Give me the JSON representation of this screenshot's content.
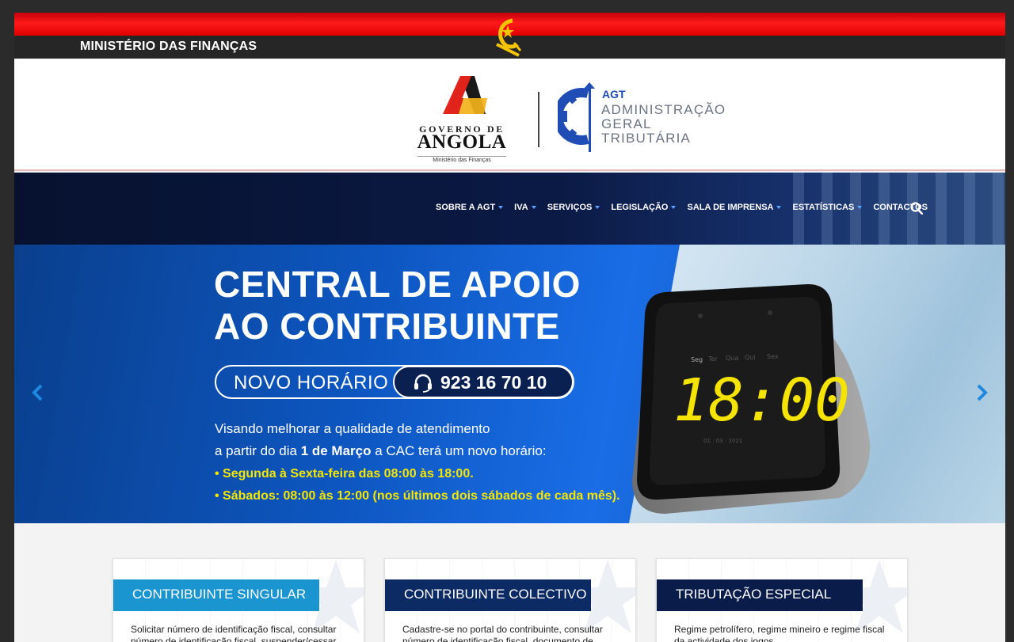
{
  "header": {
    "ministry": "MINISTÉRIO DAS FINANÇAS"
  },
  "logos": {
    "gov_line1": "GOVERNO DE",
    "gov_line2": "ANGOLA",
    "gov_line3": "Ministério das Finanças",
    "agt_short": "AGT",
    "agt_line1": "ADMINISTRAÇÃO",
    "agt_line2": "GERAL",
    "agt_line3": "TRIBUTÁRIA"
  },
  "nav": {
    "items": [
      {
        "label": "SOBRE A AGT",
        "dropdown": true
      },
      {
        "label": "IVA",
        "dropdown": true
      },
      {
        "label": "SERVIÇOS",
        "dropdown": true
      },
      {
        "label": "LEGISLAÇÃO",
        "dropdown": true
      },
      {
        "label": "SALA DE IMPRENSA",
        "dropdown": true
      },
      {
        "label": "ESTATÍSTICAS",
        "dropdown": true
      },
      {
        "label": "CONTACTOS",
        "dropdown": false
      }
    ],
    "search_icon": "search-icon"
  },
  "hero": {
    "title_line1": "CENTRAL DE APOIO",
    "title_line2": "AO CONTRIBUINTE",
    "pill_label": "NOVO HORÁRIO",
    "phone": "923 16 70 10",
    "para1": "Visando melhorar a qualidade de atendimento",
    "para2_pre": "a partir do dia ",
    "para2_bold": "1 de Março",
    "para2_post": " a CAC terá um novo horário:",
    "bullet1": "• Segunda à Sexta-feira das 08:00 às 18:00.",
    "bullet2": "• Sábados: 08:00 às 12:00 (nos últimos dois sábados de cada mês).",
    "clock_time": "18:00",
    "clock_days": [
      "Seg",
      "Ter",
      "Qua",
      "Qui",
      "Sex"
    ],
    "clock_date": "01 : 03 : 2021"
  },
  "cards": [
    {
      "title": "CONTRIBUINTE SINGULAR",
      "color": "#1b95cf",
      "text": "Solicitar número de identificação fiscal, consultar número de identificação fiscal, suspender/cessar"
    },
    {
      "title": "CONTRIBUINTE COLECTIVO",
      "color": "#0c2a63",
      "text": "Cadastre-se no portal do contribuinte, consultar número de identificação fiscal, documento de"
    },
    {
      "title": "TRIBUTAÇÃO ESPECIAL",
      "color": "#0a1d4a",
      "text": "Regime petrolífero, regime mineiro e regime fiscal da actividade dos jogos"
    }
  ],
  "colors": {
    "flag_red": "#e00000",
    "nav_dark": "#0b1a45",
    "accent_blue": "#1a6de6",
    "highlight_yellow": "#f5e600"
  }
}
